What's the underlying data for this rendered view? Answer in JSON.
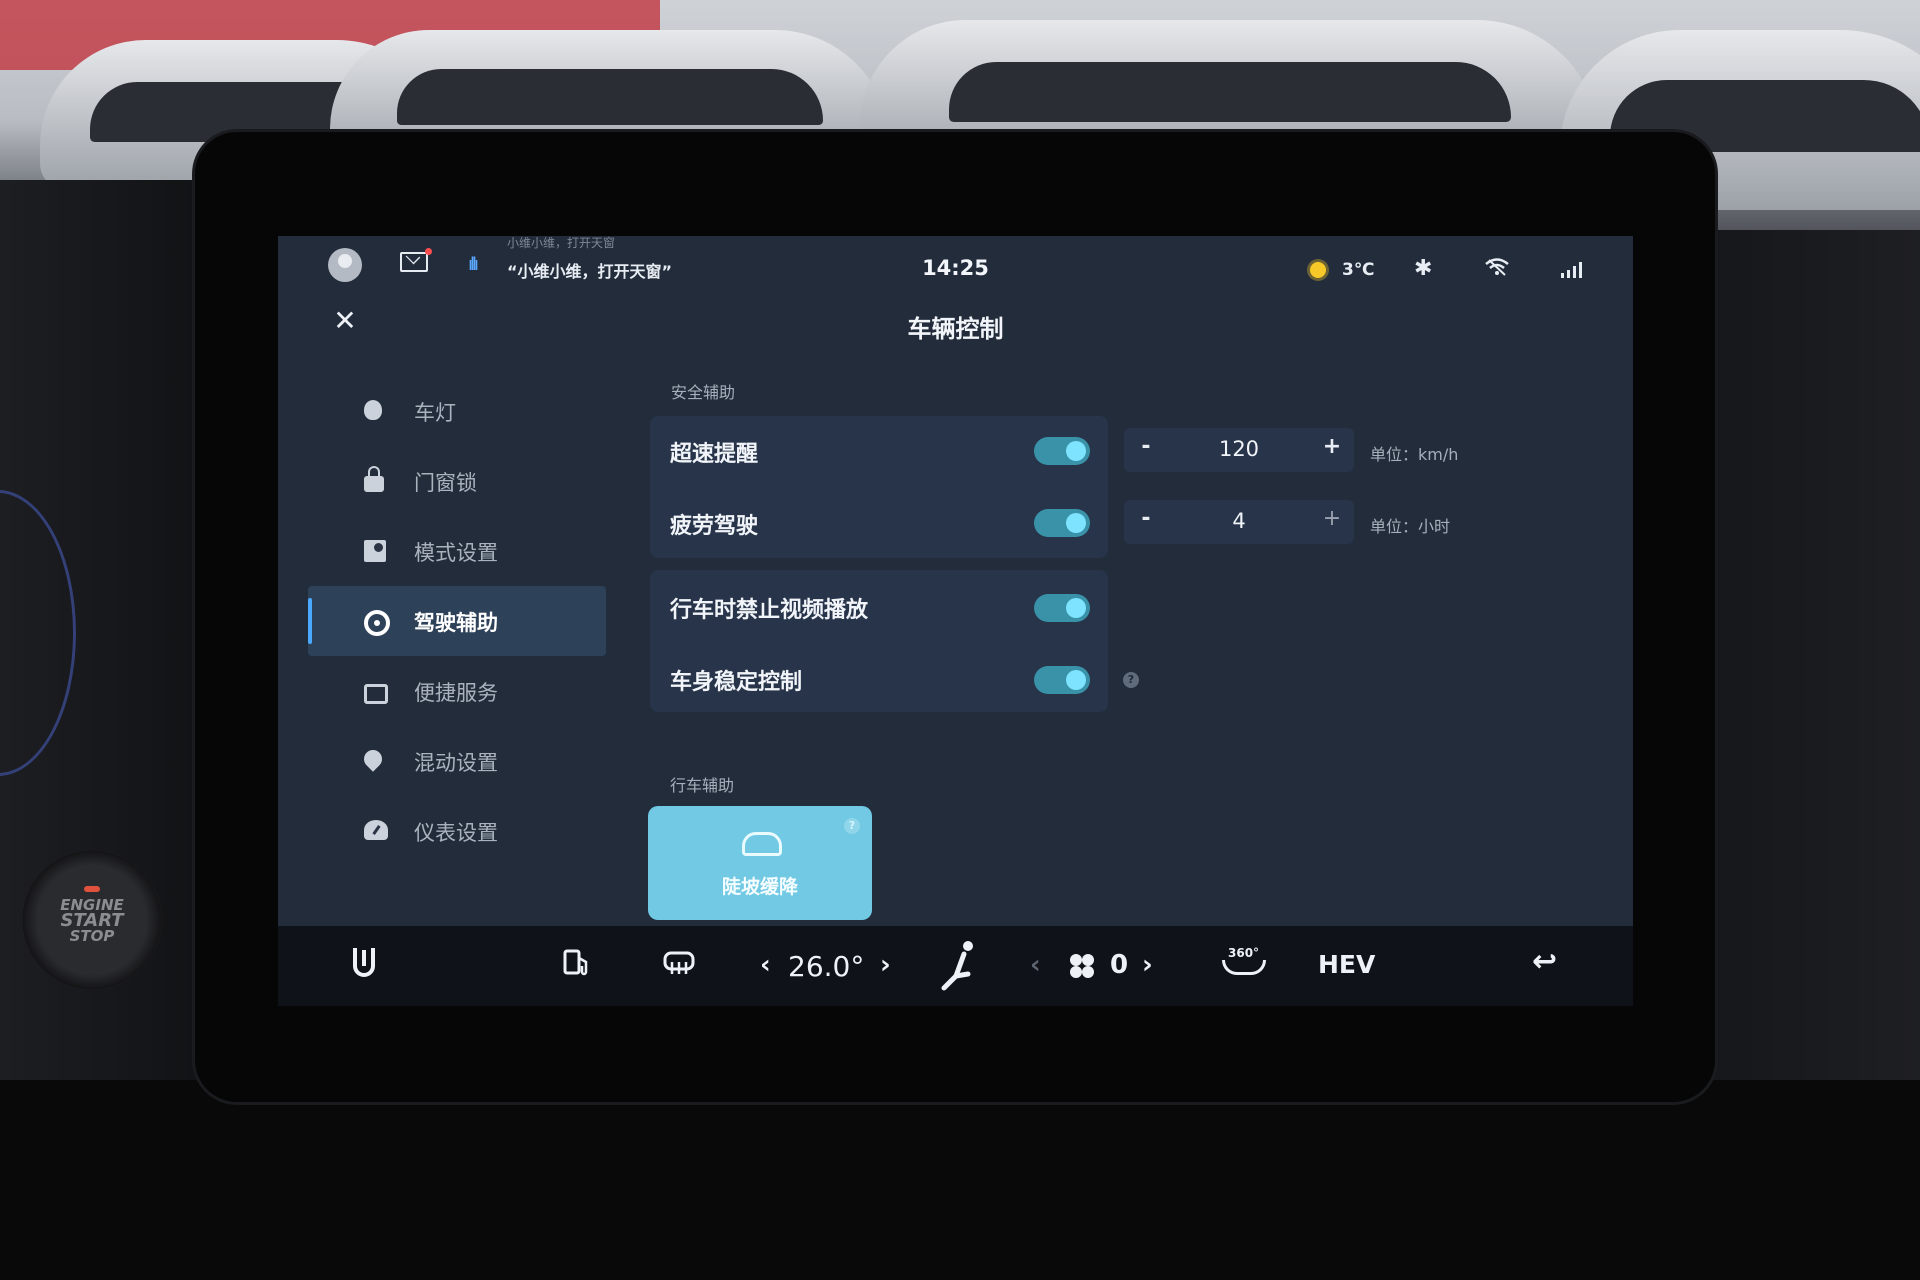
{
  "status_bar": {
    "voice_hint": "小维小维，打开天窗",
    "voice_command": "“小维小维，打开天窗”",
    "time": "14:25",
    "weather_temp": "3℃",
    "bluetooth_glyph": "✱"
  },
  "header": {
    "close_glyph": "✕",
    "title": "车辆控制"
  },
  "sidebar": {
    "items": [
      {
        "label": "车灯",
        "icon": "light-bulb-icon"
      },
      {
        "label": "门窗锁",
        "icon": "lock-icon"
      },
      {
        "label": "模式设置",
        "icon": "mode-icon"
      },
      {
        "label": "驾驶辅助",
        "icon": "steering-wheel-icon",
        "active": true
      },
      {
        "label": "便捷服务",
        "icon": "service-icon"
      },
      {
        "label": "混动设置",
        "icon": "hybrid-icon"
      },
      {
        "label": "仪表设置",
        "icon": "gauge-icon"
      }
    ]
  },
  "safety": {
    "section_title": "安全辅助",
    "overspeed": {
      "label": "超速提醒",
      "enabled": true,
      "value": "120",
      "minus": "-",
      "plus": "+",
      "unit": "单位：km/h"
    },
    "fatigue": {
      "label": "疲劳驾驶",
      "enabled": true,
      "value": "4",
      "minus": "-",
      "plus": "+",
      "unit": "单位：小时"
    },
    "no_video": {
      "label": "行车时禁止视频播放",
      "enabled": true
    },
    "esc": {
      "label": "车身稳定控制",
      "enabled": true,
      "help": "?"
    }
  },
  "driving": {
    "section_title": "行车辅助",
    "hdc": {
      "label": "陡坡缓降",
      "help": "?",
      "icon": "car-slope-icon"
    }
  },
  "dock": {
    "temp_left": "‹",
    "temperature": "26.0°",
    "temp_right": "›",
    "fan_left": "‹",
    "fan_speed": "0",
    "fan_right": "›",
    "camera_label": "360°",
    "mode_label": "HEV",
    "back_glyph": "↩"
  },
  "engine_button": {
    "line1": "ENGINE",
    "line2": "START",
    "line3": "STOP"
  },
  "colors": {
    "accent": "#4aa8ff",
    "toggle_on": "#3a92a8",
    "tile": "#72c9e4",
    "screen_bg": "#222c3b"
  }
}
